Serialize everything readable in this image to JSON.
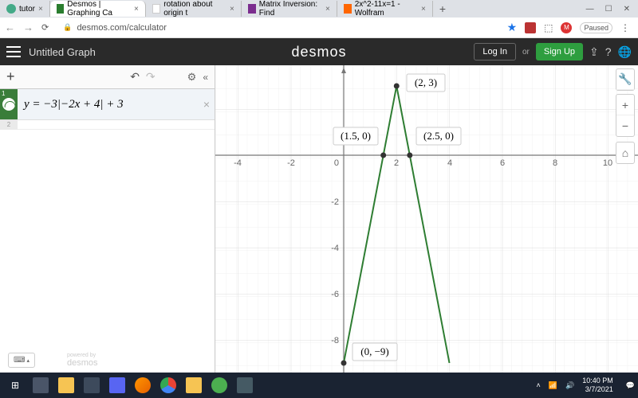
{
  "browser": {
    "tabs": [
      {
        "title": "tutor",
        "favicon": "#4a8"
      },
      {
        "title": "Desmos | Graphing Ca",
        "favicon": "#2a7d2f",
        "active": true
      },
      {
        "title": "rotation about origin t",
        "favicon": "#4285f4"
      },
      {
        "title": "Matrix Inversion: Find",
        "favicon": "#7b2"
      },
      {
        "title": "2x^2-11x=1 - Wolfram",
        "favicon": "#f60"
      }
    ],
    "url": "desmos.com/calculator",
    "paused_label": "Paused",
    "avatar_letter": "M"
  },
  "header": {
    "title": "Untitled Graph",
    "logo": "desmos",
    "login": "Log In",
    "or": "or",
    "signup": "Sign Up"
  },
  "expressions": {
    "row1_index": "1",
    "row1_formula": "y = −3|−2x + 4| + 3",
    "row2_index": "2",
    "powered": "desmos",
    "powered_pre": "powered by"
  },
  "graph": {
    "x_ticks": [
      -4,
      -2,
      0,
      2,
      4,
      6,
      8,
      10
    ],
    "y_ticks": [
      -2,
      -4,
      -6,
      -8
    ],
    "labels": {
      "vertex": "(2, 3)",
      "xint1": "(1.5, 0)",
      "xint2": "(2.5, 0)",
      "yint": "(0, −9)"
    }
  },
  "chart_data": {
    "type": "line",
    "title": "",
    "formula": "y = -3|-2x + 4| + 3",
    "x_range": [
      -5,
      11
    ],
    "y_range": [
      -9,
      3.5
    ],
    "points": [
      {
        "x": 0,
        "y": -9,
        "label": "(0, -9)"
      },
      {
        "x": 1.5,
        "y": 0,
        "label": "(1.5, 0)"
      },
      {
        "x": 2,
        "y": 3,
        "label": "(2, 3)"
      },
      {
        "x": 2.5,
        "y": 0,
        "label": "(2.5, 0)"
      }
    ],
    "series": [
      {
        "name": "y=-3|-2x+4|+3",
        "segments": [
          [
            {
              "x": 0,
              "y": -9
            },
            {
              "x": 2,
              "y": 3
            }
          ],
          [
            {
              "x": 2,
              "y": 3
            },
            {
              "x": 4,
              "y": -9
            }
          ]
        ]
      }
    ]
  },
  "taskbar": {
    "time": "10:40 PM",
    "date": "3/7/2021"
  }
}
